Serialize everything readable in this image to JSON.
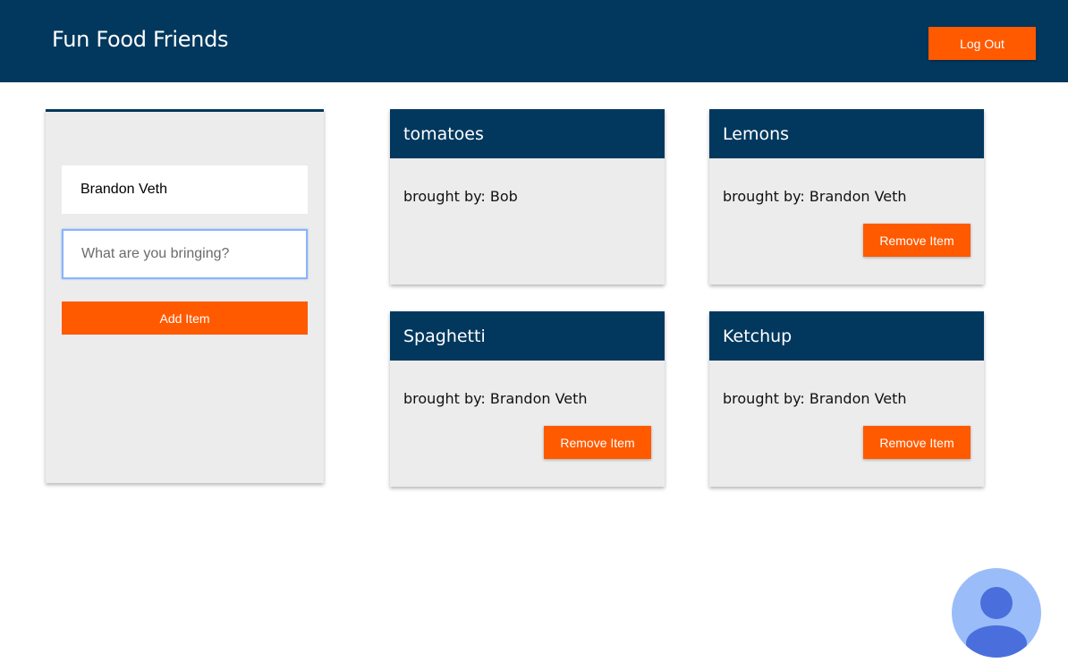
{
  "header": {
    "title": "Fun Food Friends",
    "logout_label": "Log Out"
  },
  "form": {
    "name_value": "Brandon Veth",
    "item_placeholder": "What are you bringing?",
    "add_label": "Add Item"
  },
  "items": [
    {
      "name": "tomatoes",
      "brought_by": "brought by: Bob",
      "remove_label": ""
    },
    {
      "name": "Lemons",
      "brought_by": "brought by: Brandon Veth",
      "remove_label": "Remove Item"
    },
    {
      "name": "Spaghetti",
      "brought_by": "brought by: Brandon Veth",
      "remove_label": "Remove Item"
    },
    {
      "name": "Ketchup",
      "brought_by": "brought by: Brandon Veth",
      "remove_label": "Remove Item"
    }
  ],
  "colors": {
    "header_bg": "#02385e",
    "accent": "#ff5a00",
    "panel_bg": "#ececec",
    "avatar_bg": "#9abdf9",
    "avatar_fg": "#4a6fdc"
  },
  "icons": {
    "avatar": "user-avatar-icon"
  }
}
